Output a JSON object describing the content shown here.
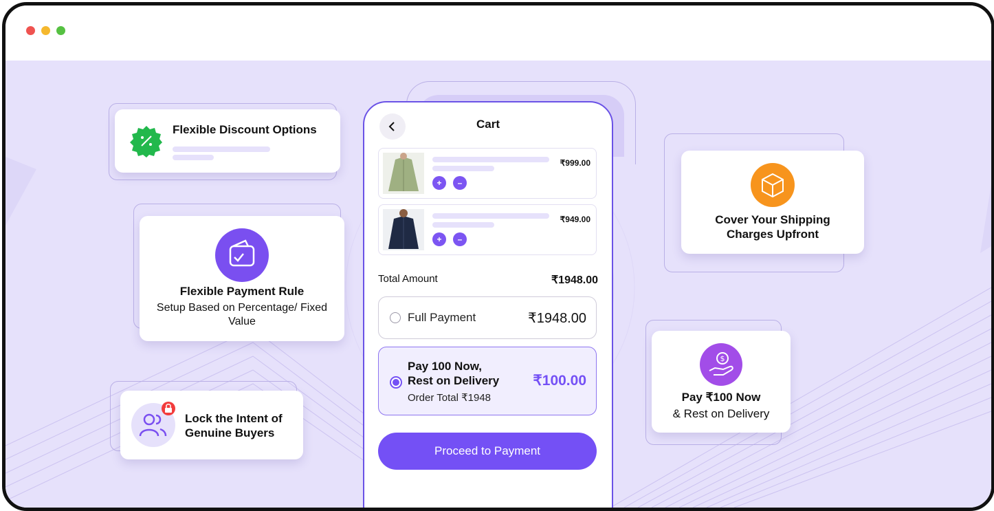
{
  "window": {
    "dots": [
      "#ef5350",
      "#f5b82e",
      "#56c142"
    ]
  },
  "features": {
    "discount": {
      "title": "Flexible Discount Options",
      "icon": "percent-badge-icon",
      "color": "#22b84c"
    },
    "payment_rule": {
      "title": "Flexible Payment Rule",
      "subtitle": "Setup Based on Percentage/ Fixed Value",
      "icon": "wallet-check-icon",
      "color": "#7a4ff0"
    },
    "lock_intent": {
      "title": "Lock the Intent of Genuine Buyers",
      "icon": "users-lock-icon",
      "badge_color": "#f23c3c"
    },
    "shipping": {
      "title": "Cover Your Shipping Charges Upfront",
      "icon": "box-icon",
      "color": "#f7941d"
    },
    "pay_now": {
      "title": "Pay ₹100 Now",
      "subtitle": "& Rest on Delivery",
      "icon": "hand-coin-icon",
      "color": "#a24de8"
    }
  },
  "cart": {
    "title": "Cart",
    "items": [
      {
        "price": "₹999.00",
        "image": "olive-jacket"
      },
      {
        "price": "₹949.00",
        "image": "navy-jacket"
      }
    ],
    "plus_label": "+",
    "minus_label": "–",
    "total_label": "Total Amount",
    "total_value": "₹1948.00",
    "options": [
      {
        "label": "Full Payment",
        "amount": "₹1948.00",
        "selected": false
      },
      {
        "label_line1": "Pay 100 Now,",
        "label_line2": "Rest on Delivery",
        "note": "Order Total ₹1948",
        "amount": "₹100.00",
        "selected": true
      }
    ],
    "cta_label": "Proceed to Payment"
  },
  "colors": {
    "accent": "#7450f5",
    "background": "#e6e1fb"
  }
}
